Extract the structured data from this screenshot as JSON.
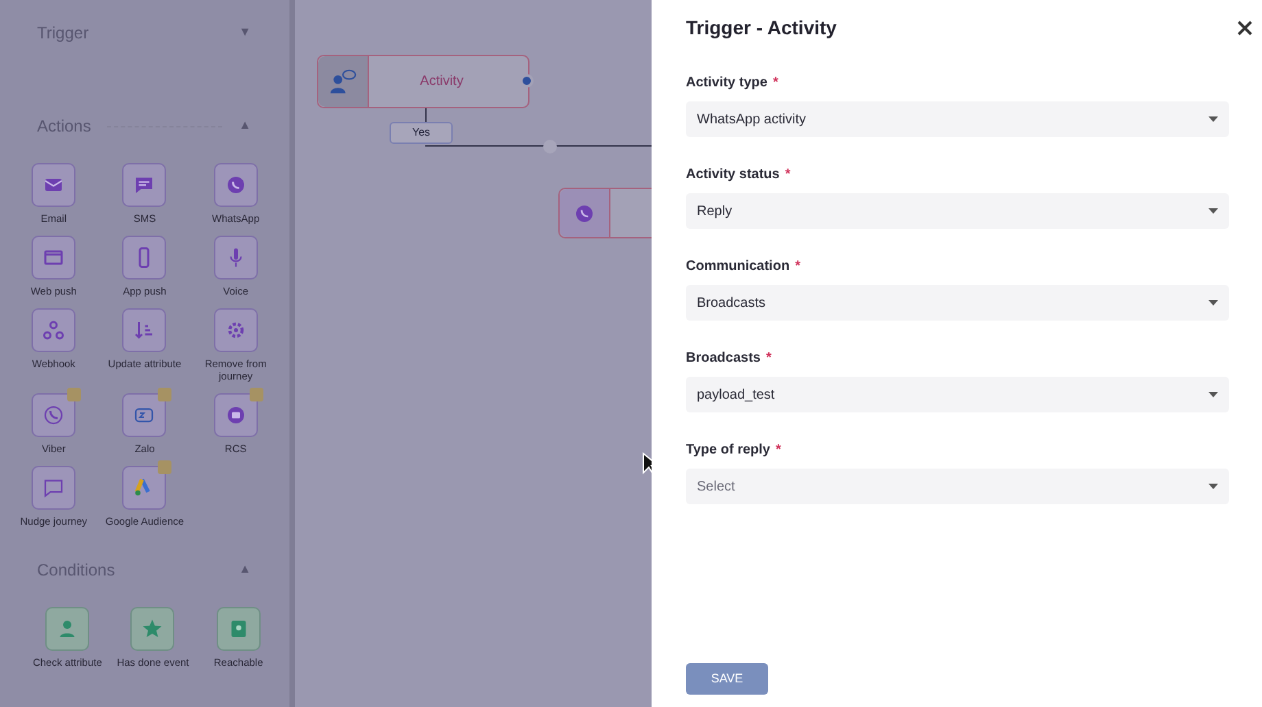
{
  "sidebar": {
    "sections": [
      {
        "title": "Trigger",
        "toggle": "▼"
      },
      {
        "title": "Actions",
        "toggle": "▲",
        "items": [
          {
            "label": "Email",
            "premium": false
          },
          {
            "label": "SMS",
            "premium": false
          },
          {
            "label": "WhatsApp",
            "premium": false
          },
          {
            "label": "Web push",
            "premium": false
          },
          {
            "label": "App push",
            "premium": false
          },
          {
            "label": "Voice",
            "premium": false
          },
          {
            "label": "Webhook",
            "premium": false
          },
          {
            "label": "Update attribute",
            "premium": false
          },
          {
            "label": "Remove from journey",
            "premium": false
          },
          {
            "label": "Viber",
            "premium": true
          },
          {
            "label": "Zalo",
            "premium": true
          },
          {
            "label": "RCS",
            "premium": true
          },
          {
            "label": "Nudge journey",
            "premium": false
          },
          {
            "label": "Google Audience",
            "premium": true
          }
        ]
      },
      {
        "title": "Conditions",
        "toggle": "▲",
        "items": [
          {
            "label": "Check attribute",
            "premium": false
          },
          {
            "label": "Has done event",
            "premium": false
          },
          {
            "label": "Reachable",
            "premium": false
          }
        ]
      }
    ]
  },
  "canvas": {
    "node": {
      "title": "Activity"
    },
    "branch": {
      "label": "Yes"
    }
  },
  "drawer": {
    "title": "Trigger - Activity",
    "fields": [
      {
        "label": "Activity type",
        "required_mark": "*",
        "value": "WhatsApp activity"
      },
      {
        "label": "Activity status",
        "required_mark": "*",
        "value": "Reply"
      },
      {
        "label": "Communication",
        "required_mark": "*",
        "value": "Broadcasts"
      },
      {
        "label": "Broadcasts",
        "required_mark": "*",
        "value": "payload_test"
      },
      {
        "label": "Type of reply",
        "required_mark": "*",
        "placeholder": "Select"
      }
    ],
    "button": {
      "label": "SAVE",
      "disabled": true
    }
  }
}
